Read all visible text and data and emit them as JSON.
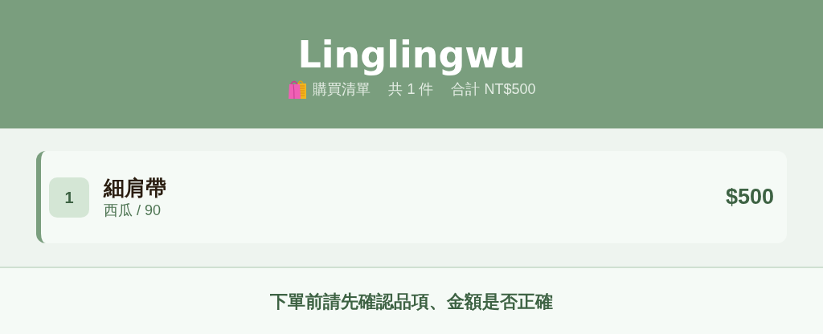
{
  "header": {
    "title": "Linglingwu",
    "list_label": "購買清單",
    "count": "共 1 件",
    "total": "合計 NT$500"
  },
  "items": [
    {
      "index": "1",
      "name": "細肩帶",
      "variant": "西瓜 / 90",
      "price": "$500"
    }
  ],
  "footer": {
    "notice": "下單前請先確認品項、金額是否正確"
  }
}
